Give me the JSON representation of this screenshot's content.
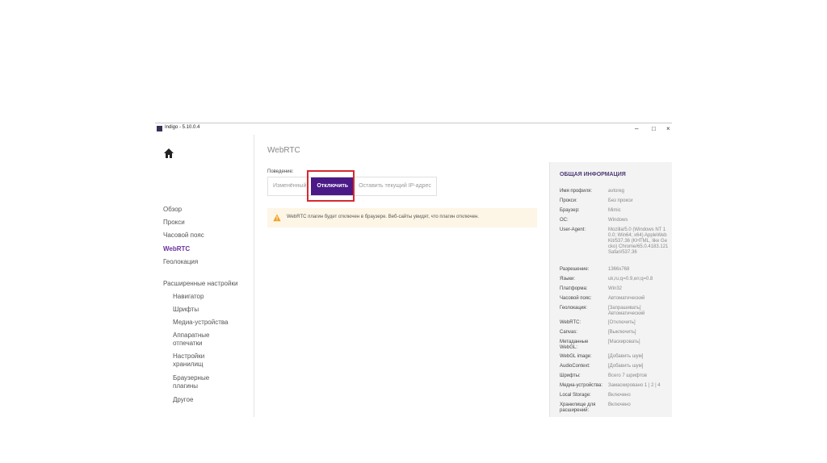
{
  "window": {
    "title": "Indigo - 5.10.0.4",
    "minimize": "–",
    "maximize": "□",
    "close": "×"
  },
  "sidebar": {
    "items": [
      "Обзор",
      "Прокси",
      "Часовой пояс",
      "WebRTC",
      "Геолокация"
    ],
    "advanced_header": "Расширенные настройки",
    "sub_items": [
      "Навигатор",
      "Шрифты",
      "Медиа-устройства",
      "Аппаратные отпечатки",
      "Настройки хранилищ",
      "Браузерные плагины",
      "Другое"
    ]
  },
  "main": {
    "title": "WebRTC",
    "behavior_label": "Поведение:",
    "options": [
      "Изменённый",
      "Отключить",
      "Оставить текущий IP-адрес"
    ],
    "selected": "Отключить",
    "alert": "WebRTC плагин будет отключен в браузере. Веб-сайты увидят, что плагин отключен."
  },
  "info_panel": {
    "title": "ОБЩАЯ ИНФОРМАЦИЯ",
    "rows": [
      {
        "k": "Имя профиля:",
        "v": "avtoreg"
      },
      {
        "k": "Прокси:",
        "v": "Без прокси"
      },
      {
        "k": "Браузер:",
        "v": "Mimic"
      },
      {
        "k": "ОС:",
        "v": "Windows"
      },
      {
        "k": "User-Agent:",
        "v": "Mozilla/5.0 (Windows NT 10.0; Win64; x64) AppleWebKit/537.36 (KHTML, like Gecko) Chrome/65.0.4183.121 Safari/537.36"
      },
      {
        "k": "Разрешение:",
        "v": "1366x768"
      },
      {
        "k": "Языки:",
        "v": "uk,ru;q=0.9,en;q=0.8"
      },
      {
        "k": "Платформа:",
        "v": "Win32"
      },
      {
        "k": "Часовой пояс:",
        "v": "Автоматический"
      },
      {
        "k": "Геолокация:",
        "v": "[Запрашивать] Автоматический"
      },
      {
        "k": "WebRTC:",
        "v": "[Отключить]"
      },
      {
        "k": "Canvas:",
        "v": "[Выключить]"
      },
      {
        "k": "Метаданные WebGL:",
        "v": "[Маскировать]"
      },
      {
        "k": "WebGL image:",
        "v": "[Добавить шум]"
      },
      {
        "k": "AudioContext:",
        "v": "[Добавить шум]"
      },
      {
        "k": "Шрифты:",
        "v": "Всего 7 шрифтов"
      },
      {
        "k": "Медиа-устройства:",
        "v": "Замаскировано 1 | 2 | 4"
      },
      {
        "k": "Local Storage:",
        "v": "Включено"
      },
      {
        "k": "Хранилище для расширений:",
        "v": "Включено"
      }
    ]
  },
  "colors": {
    "accent": "#4b1a87",
    "highlight": "#d8292f",
    "alert_bg": "#fdf5e6",
    "warning": "#f0a020"
  }
}
